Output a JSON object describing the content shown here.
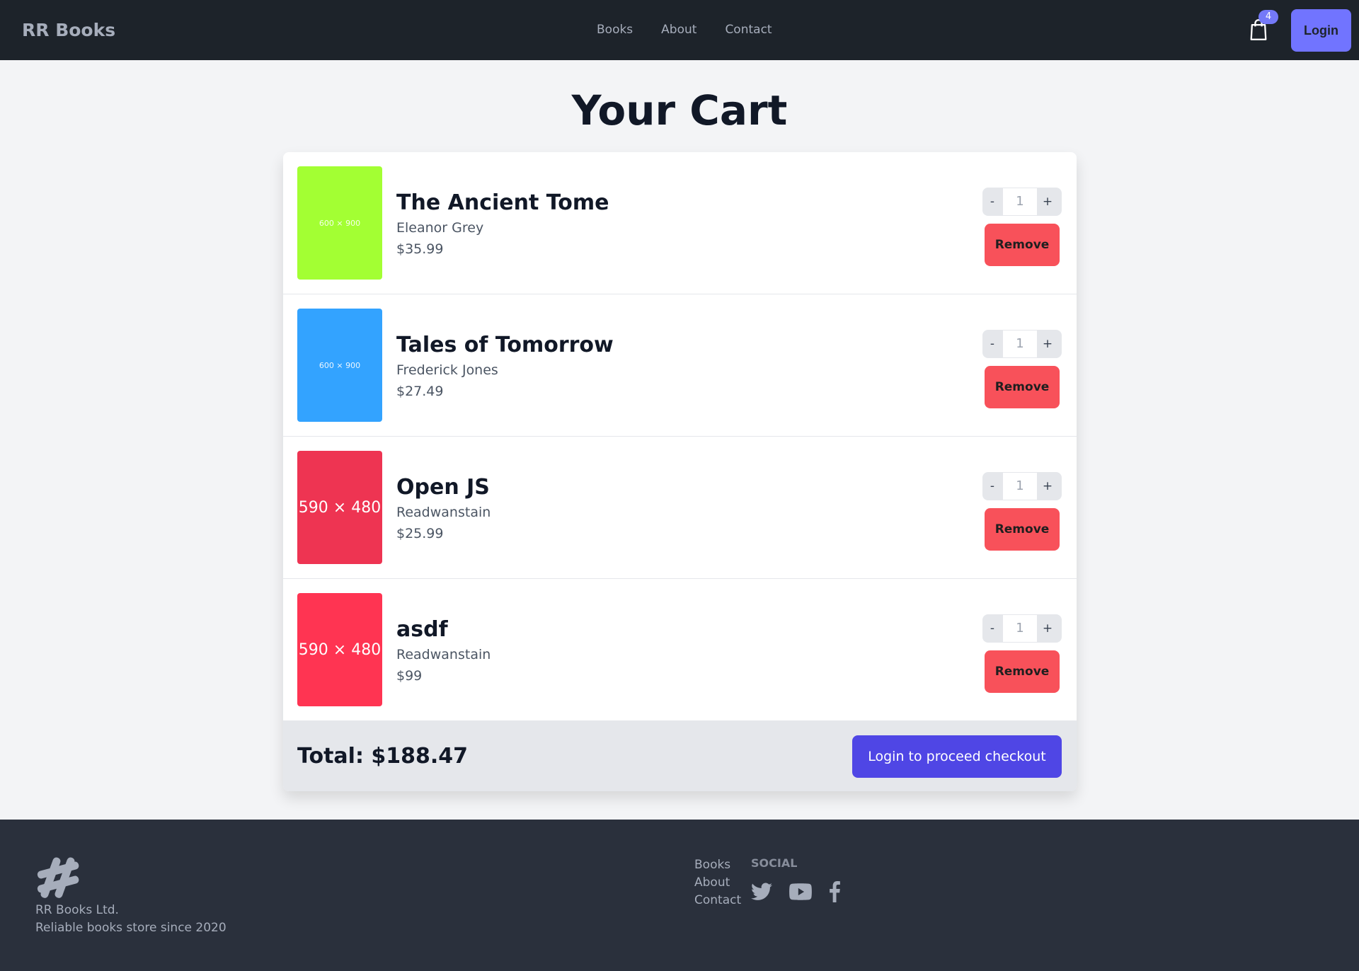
{
  "navbar": {
    "brand": "RR Books",
    "links": [
      "Books",
      "About",
      "Contact"
    ],
    "cart_count": "4",
    "login_label": "Login"
  },
  "page_title": "Your Cart",
  "items": [
    {
      "title": "The Ancient Tome",
      "author": "Eleanor Grey",
      "price": "$35.99",
      "qty": "1",
      "thumb_label": "600 × 900",
      "thumb_color": "#a3ff33"
    },
    {
      "title": "Tales of Tomorrow",
      "author": "Frederick Jones",
      "price": "$27.49",
      "qty": "1",
      "thumb_label": "600 × 900",
      "thumb_color": "#33a3ff"
    },
    {
      "title": "Open JS",
      "author": "Readwanstain",
      "price": "$25.99",
      "qty": "1",
      "thumb_label": "590 × 480",
      "thumb_color": "#ee3452"
    },
    {
      "title": "asdf",
      "author": "Readwanstain",
      "price": "$99",
      "qty": "1",
      "thumb_label": "590 × 480",
      "thumb_color": "#ff3452"
    }
  ],
  "item_controls": {
    "dec": "-",
    "inc": "+",
    "remove": "Remove"
  },
  "total": "Total: $188.47",
  "checkout_label": "Login to proceed checkout",
  "footer": {
    "company": "RR Books Ltd.",
    "tagline": "Reliable books store since 2020",
    "links": [
      "Books",
      "About",
      "Contact"
    ],
    "social_title": "SOCIAL",
    "social_icons": [
      "twitter-icon",
      "youtube-icon",
      "facebook-icon"
    ]
  }
}
